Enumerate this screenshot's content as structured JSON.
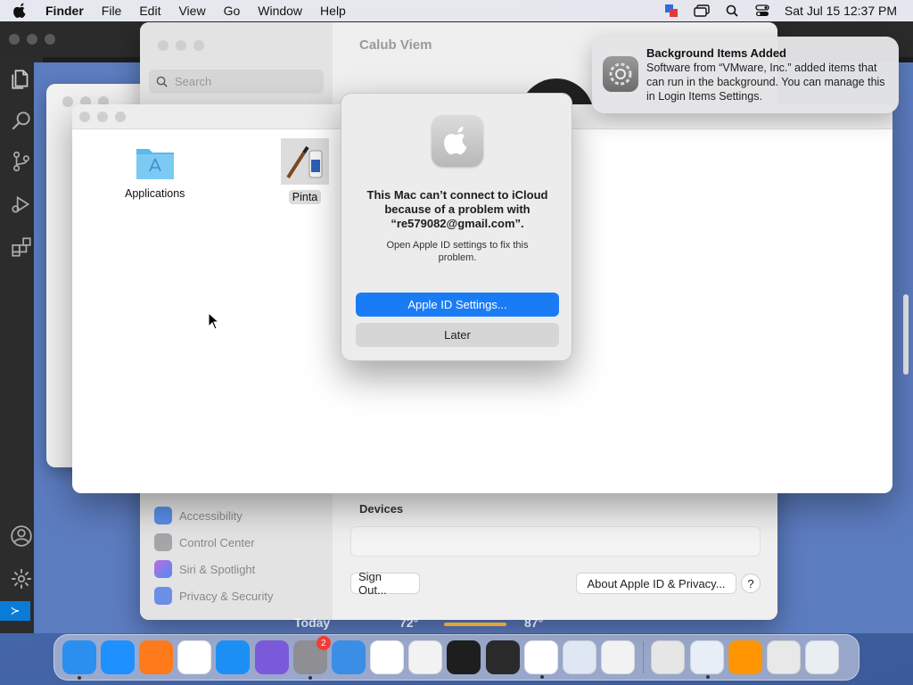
{
  "menubar": {
    "app_name": "Finder",
    "items": [
      "File",
      "Edit",
      "View",
      "Go",
      "Window",
      "Help"
    ],
    "clock": "Sat Jul 15  12:37 PM"
  },
  "settings_window": {
    "title": "Calub Viem",
    "search_placeholder": "Search",
    "sidebar_items": [
      {
        "label": "Accessibility",
        "icon": "accessibility-icon",
        "color": "#2f7ef5"
      },
      {
        "label": "Control Center",
        "icon": "control-center-icon",
        "color": "#8e8e93"
      },
      {
        "label": "Siri & Spotlight",
        "icon": "siri-icon",
        "color": "#b04cd9"
      },
      {
        "label": "Privacy & Security",
        "icon": "hand-icon",
        "color": "#3d6fe0"
      }
    ],
    "devices_title": "Devices",
    "sign_out_label": "Sign Out...",
    "about_label": "About Apple ID & Privacy...",
    "help_label": "?"
  },
  "finder": {
    "items": [
      {
        "label": "Applications",
        "icon": "applications-folder-icon"
      },
      {
        "label": "Pinta",
        "icon": "pinta-app-icon"
      }
    ]
  },
  "alert": {
    "title": "This Mac can’t connect to iCloud because of a problem with “re579082@gmail.com”.",
    "message": "Open Apple ID settings to fix this problem.",
    "primary_button": "Apple ID Settings...",
    "secondary_button": "Later"
  },
  "notification": {
    "title": "Background Items Added",
    "body": "Software from “VMware, Inc.” added items that can run in the background. You can manage this in Login Items Settings."
  },
  "widget": {
    "today": "Today",
    "low_temp": "72°",
    "high_temp": "87°"
  },
  "dock": {
    "apps": [
      {
        "name": "Finder",
        "icon": "finder-icon",
        "color": "#2b8ff0",
        "running": true
      },
      {
        "name": "Safari",
        "icon": "safari-icon",
        "color": "#1e90ff",
        "running": false
      },
      {
        "name": "Firefox",
        "icon": "firefox-icon",
        "color": "#ff7a1a",
        "running": false
      },
      {
        "name": "Chrome",
        "icon": "chrome-icon",
        "color": "#ffffff",
        "running": false
      },
      {
        "name": "App Store",
        "icon": "app-store-icon",
        "color": "#1c8ff5",
        "running": false
      },
      {
        "name": "Podcasts-like",
        "icon": "purple-app-icon",
        "color": "#7a5ad8",
        "running": false
      },
      {
        "name": "System Settings",
        "icon": "settings-icon",
        "color": "#8e8e93",
        "running": true,
        "badge": "2"
      },
      {
        "name": "Weather",
        "icon": "weather-icon",
        "color": "#3a8ee6",
        "running": false
      },
      {
        "name": "Visual Studio",
        "icon": "visual-studio-icon",
        "color": "#ffffff",
        "running": false
      },
      {
        "name": "TextEdit",
        "icon": "textedit-icon",
        "color": "#f2f2f2",
        "running": false
      },
      {
        "name": "Terminal",
        "icon": "terminal-icon",
        "color": "#1e1e1e",
        "running": false
      },
      {
        "name": "Console",
        "icon": "console-icon",
        "color": "#2a2a2a",
        "running": false
      },
      {
        "name": "VS Code",
        "icon": "vscode-icon",
        "color": "#ffffff",
        "running": true
      },
      {
        "name": "Preview",
        "icon": "preview-icon",
        "color": "#dfe8f2",
        "running": false
      },
      {
        "name": "Launchpad",
        "icon": "launchpad-icon",
        "color": "#f2f2f2",
        "running": false
      }
    ],
    "apps_right": [
      {
        "name": "Calculator",
        "icon": "calculator-icon",
        "color": "#e6e6e6",
        "running": false
      },
      {
        "name": "VMware",
        "icon": "vmware-icon",
        "color": "#e8eef8",
        "running": true
      },
      {
        "name": "Books",
        "icon": "books-icon",
        "color": "#ff9500",
        "running": false
      },
      {
        "name": "Pinta",
        "icon": "pinta-app-icon",
        "color": "#e8e8e8",
        "running": false
      },
      {
        "name": "Trash",
        "icon": "trash-icon",
        "color": "#e9eef3",
        "running": false
      }
    ]
  }
}
